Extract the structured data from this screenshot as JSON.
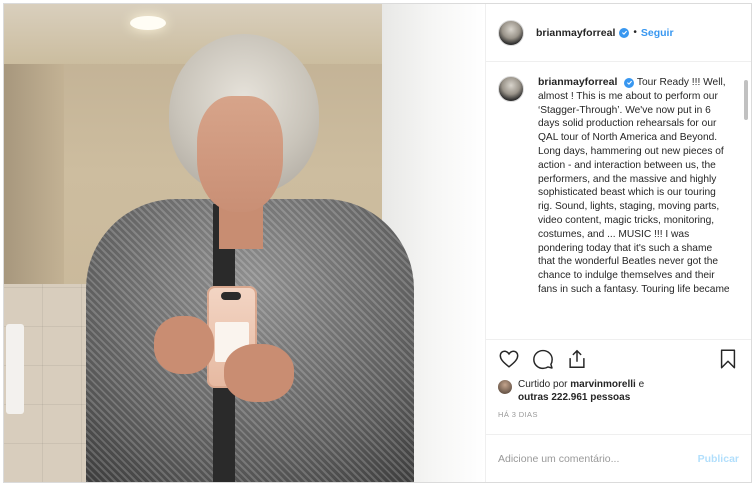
{
  "post": {
    "username": "brianmayforreal",
    "follow_label": "Seguir",
    "separator": "•",
    "verified": true
  },
  "caption": {
    "username": "brianmayforreal",
    "text": "Tour Ready !!! Well, almost ! This is me about to perform our ‘Stagger-Through’. We've now put in 6 days solid production rehearsals for our QAL tour of North America and Beyond. Long days, hammering out new pieces of action - and interaction between us, the performers, and the massive and highly sophisticated beast which is our touring rig. Sound, lights, staging, moving parts, video content, magic tricks, monitoring, costumes, and ... MUSIC !!! I was pondering today that it's such a shame that the wonderful Beatles never got the chance to indulge themselves and their fans in such a fantasy. Touring life became"
  },
  "likes": {
    "prefix": "Curtido por",
    "liker": "marvinmorelli",
    "connector": "e",
    "others": "outras 222.961 pessoas"
  },
  "timestamp": "HÁ 3 DIAS",
  "comment_box": {
    "placeholder": "Adicione um comentário...",
    "publish_label": "Publicar"
  },
  "icons": {
    "like": "heart-icon",
    "comment": "comment-icon",
    "share": "share-icon",
    "save": "bookmark-icon",
    "verified": "verified-badge-icon"
  },
  "colors": {
    "accent": "#3897f0",
    "publish_disabled": "#b2dffc",
    "text": "#262626",
    "muted": "#999999"
  }
}
